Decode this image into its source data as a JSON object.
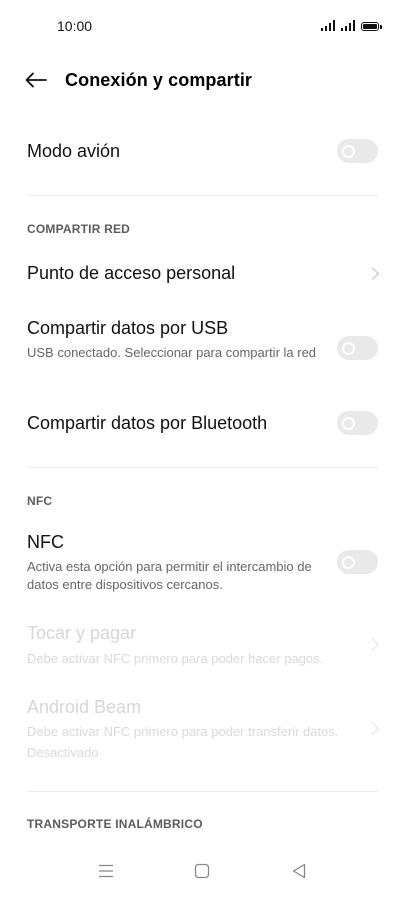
{
  "status_bar": {
    "time": "10:00",
    "icons": [
      "signal-icon",
      "signal-icon",
      "battery-icon"
    ]
  },
  "header": {
    "title": "Conexión y compartir",
    "back_icon": "arrow-left-icon"
  },
  "airplane": {
    "title": "Modo avión",
    "enabled": false
  },
  "sections": {
    "share_network": "COMPARTIR RED",
    "nfc": "NFC",
    "wireless_transport": "TRANSPORTE INALÁMBRICO"
  },
  "hotspot": {
    "title": "Punto de acceso personal"
  },
  "usb_tethering": {
    "title": "Compartir datos por USB",
    "subtitle": "USB conectado. Seleccionar para compartir la red",
    "enabled": false
  },
  "bt_tethering": {
    "title": "Compartir datos por Bluetooth",
    "enabled": false
  },
  "nfc": {
    "title": "NFC",
    "subtitle": "Activa esta opción para permitir el intercambio de datos entre dispositivos cercanos.",
    "enabled": false
  },
  "tap_pay": {
    "title": "Tocar y pagar",
    "subtitle": "Debe activar NFC primero para poder hacer pagos.",
    "disabled": true
  },
  "android_beam": {
    "title": "Android Beam",
    "subtitle": "Debe activar NFC primero para poder transferir datos.",
    "status": "Desactivado",
    "disabled": true
  },
  "nav_bar": {
    "icons": [
      "menu-icon",
      "home-icon",
      "back-icon"
    ]
  },
  "colors": {
    "toggle_off_track": "#e9e9e9",
    "disabled_text": "#d7d7d7",
    "secondary_text": "#666666"
  }
}
